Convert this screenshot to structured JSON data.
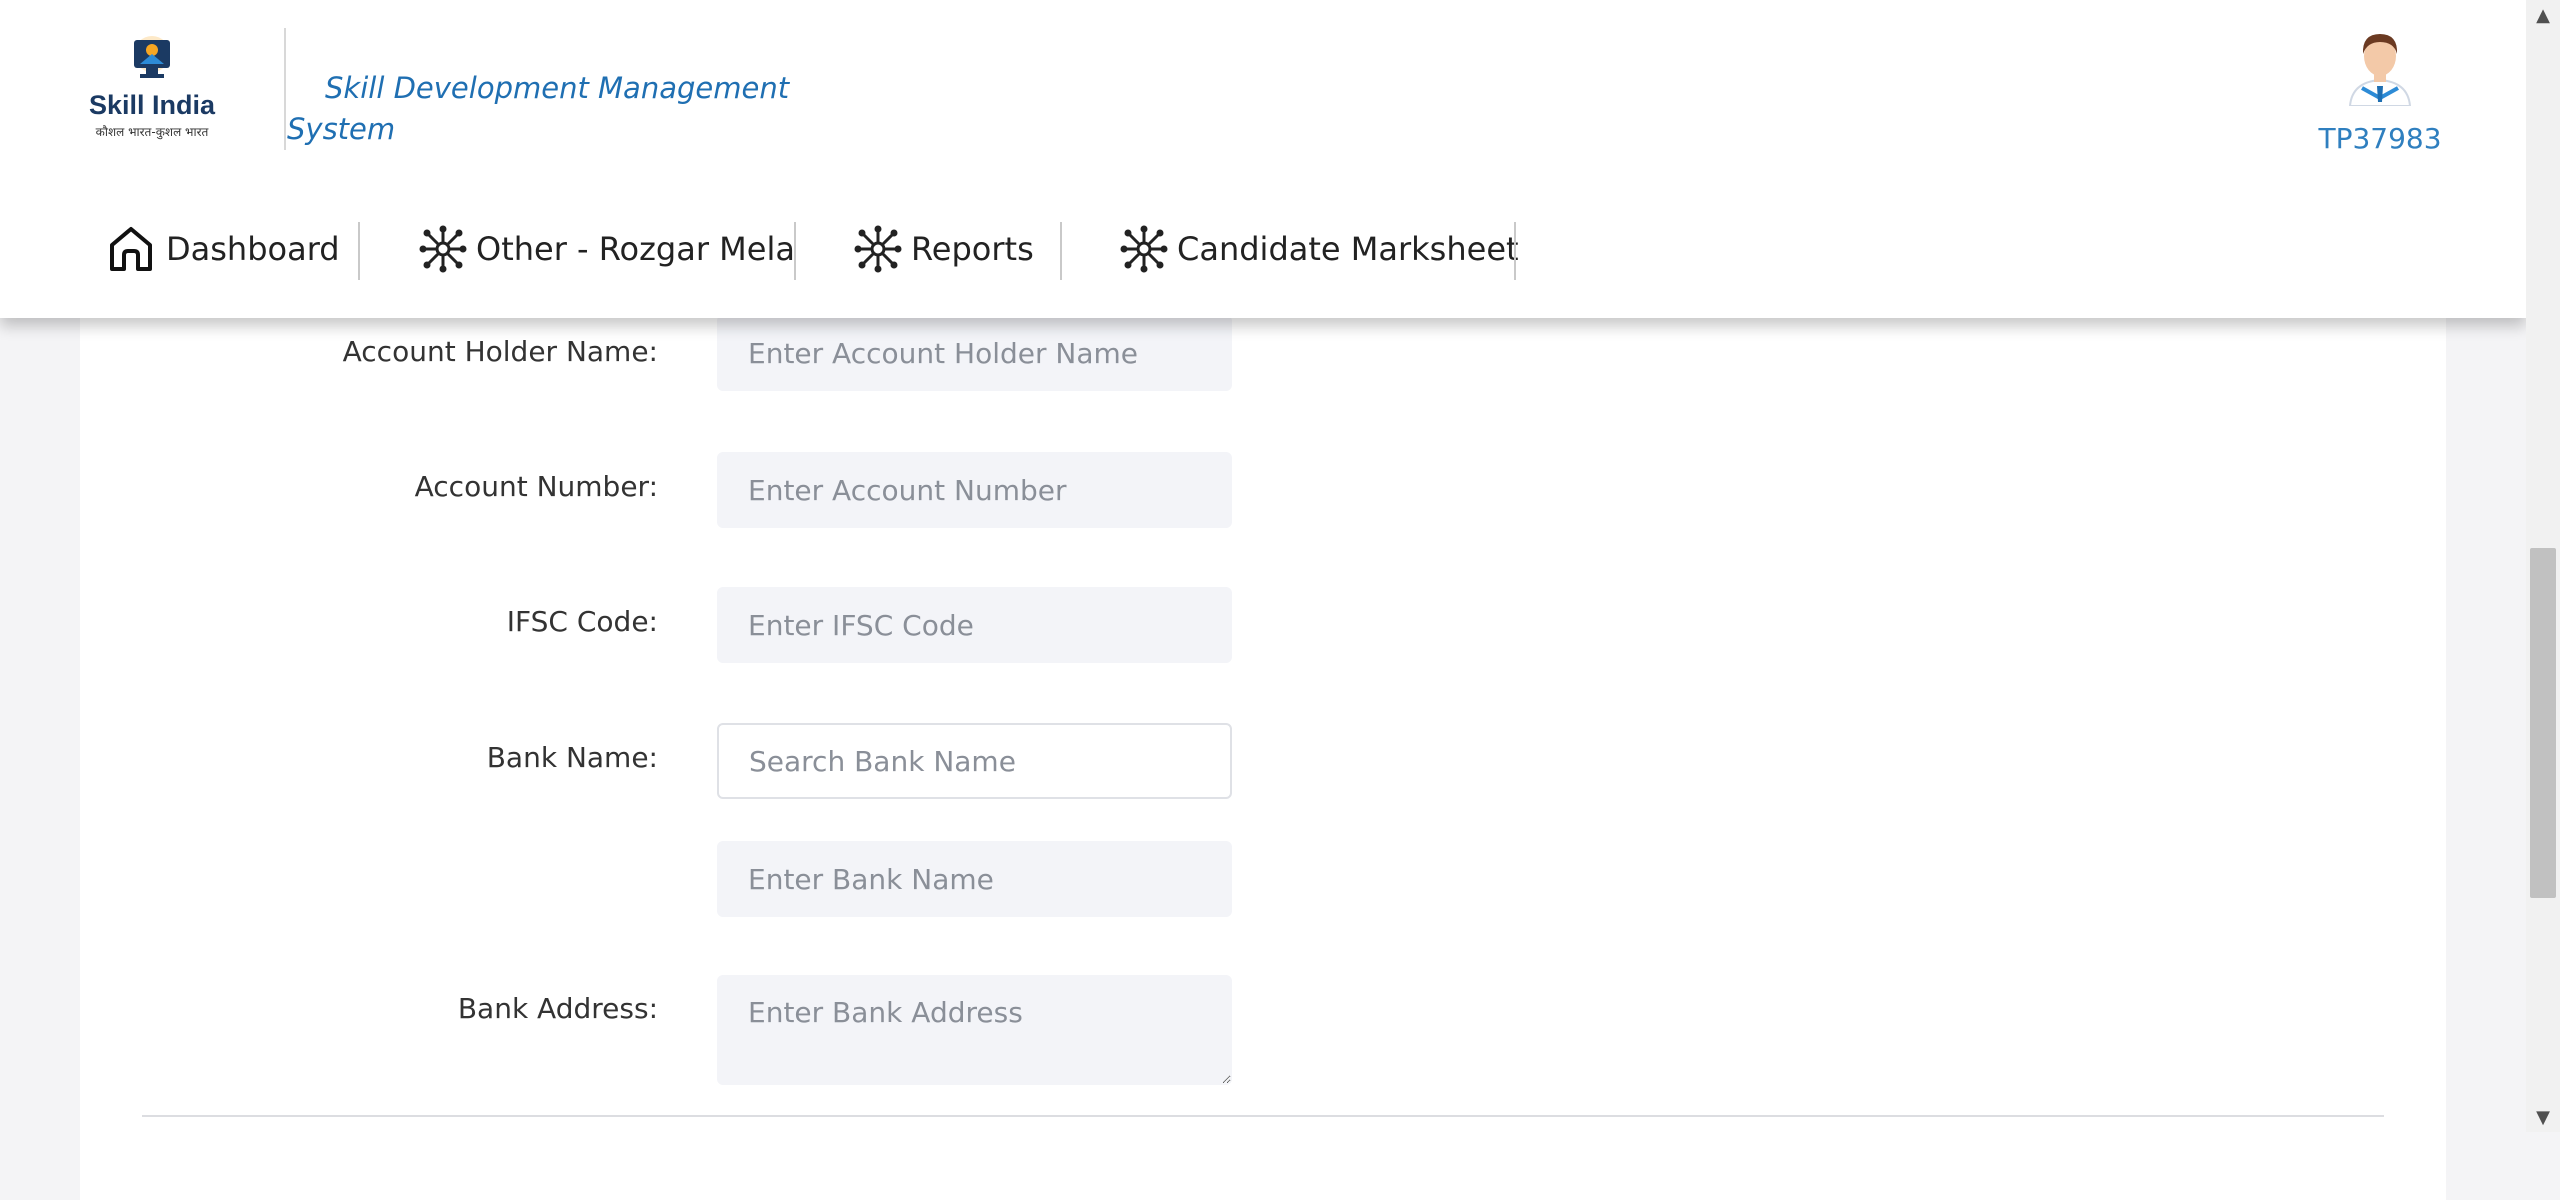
{
  "header": {
    "app_title": "Skill Development Management System",
    "logo_text": "Skill India",
    "logo_subtext": "कौशल भारत-कुशल भारत",
    "user_id": "TP37983"
  },
  "nav": {
    "items": [
      {
        "label": "Dashboard",
        "icon": "home-icon"
      },
      {
        "label": "Other - Rozgar Mela",
        "icon": "network-icon"
      },
      {
        "label": "Reports",
        "icon": "network-icon"
      },
      {
        "label": "Candidate Marksheet",
        "icon": "network-icon"
      }
    ]
  },
  "form": {
    "account_holder": {
      "label": "Account Holder Name:",
      "placeholder": "Enter Account Holder Name"
    },
    "account_number": {
      "label": "Account Number:",
      "placeholder": "Enter Account Number"
    },
    "ifsc": {
      "label": "IFSC Code:",
      "placeholder": "Enter IFSC Code"
    },
    "bank_name": {
      "label": "Bank Name:",
      "search_placeholder": "Search Bank Name",
      "placeholder": "Enter Bank Name"
    },
    "bank_address": {
      "label": "Bank Address:",
      "placeholder": "Enter Bank Address"
    }
  },
  "colors": {
    "accent": "#1f6fb2",
    "input_bg": "#f3f4f8",
    "page_bg": "#f4f4f6"
  }
}
